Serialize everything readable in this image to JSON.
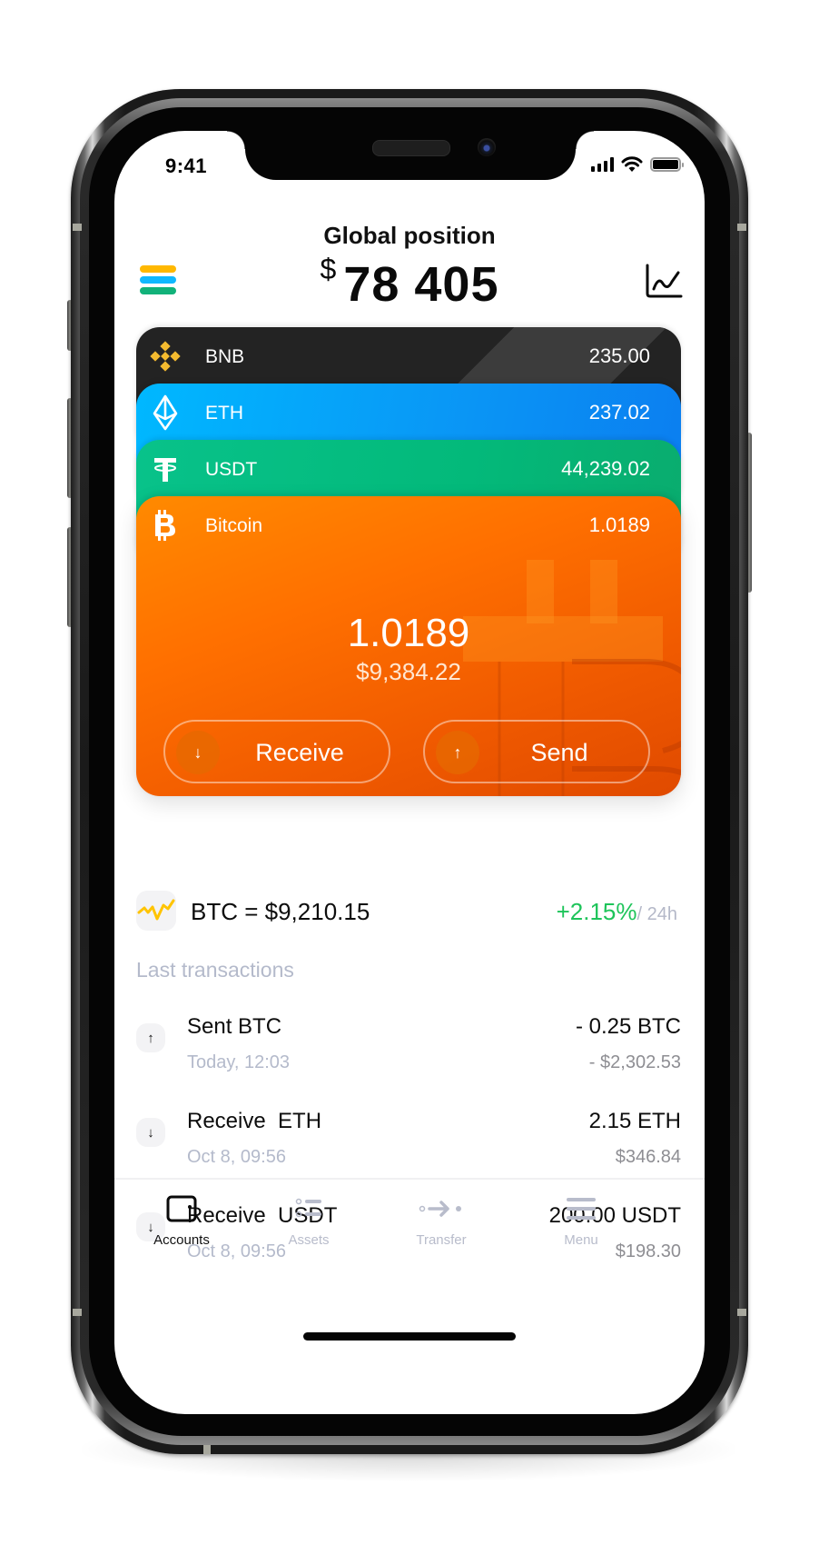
{
  "status_bar": {
    "time": "9:41"
  },
  "header": {
    "title": "Global position",
    "currency_symbol": "$",
    "total": "78 405",
    "menu_colors": [
      "#ffb800",
      "#10b8ff",
      "#12b27a"
    ]
  },
  "cards": [
    {
      "name": "BNB",
      "value": "235.00",
      "icon": "bnb-icon",
      "color": "#232323",
      "icon_color": "#f3ba2f"
    },
    {
      "name": "ETH",
      "value": "237.02",
      "icon": "eth-icon",
      "color": "#0a95f5"
    },
    {
      "name": "USDT",
      "value": "44,239.02",
      "icon": "tether-icon",
      "color": "#03b97a"
    },
    {
      "name": "Bitcoin",
      "value": "1.0189",
      "icon": "bitcoin-icon",
      "color": "#ff7000"
    }
  ],
  "active_card": {
    "amount": "1.0189",
    "fiat": "$9,384.22",
    "receive_label": "Receive",
    "send_label": "Send",
    "receive_icon": "↓",
    "send_icon": "↑"
  },
  "rate": {
    "text": "BTC = $9,210.15",
    "change": "+2.15%",
    "period": "/ 24h",
    "positive_color": "#1ec45a"
  },
  "transactions_title": "Last transactions",
  "transactions": [
    {
      "direction": "↑",
      "title": "Sent BTC",
      "date": "Today, 12:03",
      "amount": "- 0.25 BTC",
      "fiat": "- $2,302.53"
    },
    {
      "direction": "↓",
      "title": "Receive  ETH",
      "date": "Oct 8, 09:56",
      "amount": "2.15 ETH",
      "fiat": "$346.84"
    },
    {
      "direction": "↓",
      "title": "Receive  USDT",
      "date": "Oct 8, 09:56",
      "amount": "200.00 USDT",
      "fiat": "$198.30"
    }
  ],
  "tabbar": {
    "items": [
      {
        "label": "Accounts",
        "icon": "wallet-icon",
        "active": true
      },
      {
        "label": "Assets",
        "icon": "list-icon",
        "active": false
      },
      {
        "label": "Transfer",
        "icon": "transfer-icon",
        "active": false
      },
      {
        "label": "Menu",
        "icon": "menu-icon",
        "active": false
      }
    ]
  }
}
